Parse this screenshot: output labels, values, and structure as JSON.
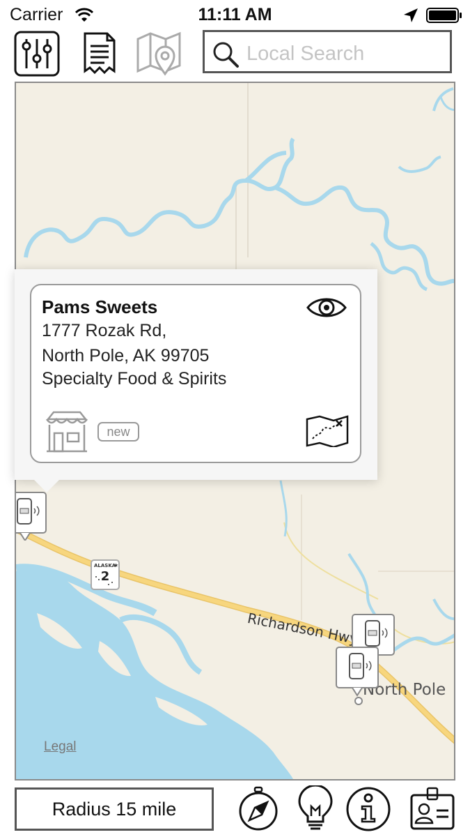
{
  "status_bar": {
    "carrier": "Carrier",
    "time": "11:11 AM",
    "icons": [
      "wifi-icon",
      "location-arrow-icon",
      "battery-icon"
    ]
  },
  "toolbar": {
    "buttons": [
      "filter-sliders-icon",
      "receipt-list-icon",
      "map-pin-icon"
    ],
    "search_placeholder": "Local Search",
    "search_value": ""
  },
  "map": {
    "road_label": "Richardson Hwy",
    "city_label": "North Pole",
    "legal_link": "Legal",
    "route_shield_state": "ALASKA",
    "route_shield_number": "2",
    "colors": {
      "land": "#f3efe4",
      "water": "#a8d8ec",
      "highway": "#f7d67e"
    }
  },
  "callout": {
    "name": "Pams Sweets",
    "address_line1": "1777 Rozak Rd,",
    "address_line2": "North Pole, AK 99705",
    "category": "Specialty Food & Spirits",
    "badge": "new",
    "icons": [
      "eye-icon",
      "storefront-icon",
      "treasure-map-icon"
    ]
  },
  "bottom_bar": {
    "radius_label": "Radius 15 mile",
    "buttons": [
      "compass-icon",
      "lightbulb-icon",
      "info-icon",
      "id-card-icon"
    ]
  }
}
